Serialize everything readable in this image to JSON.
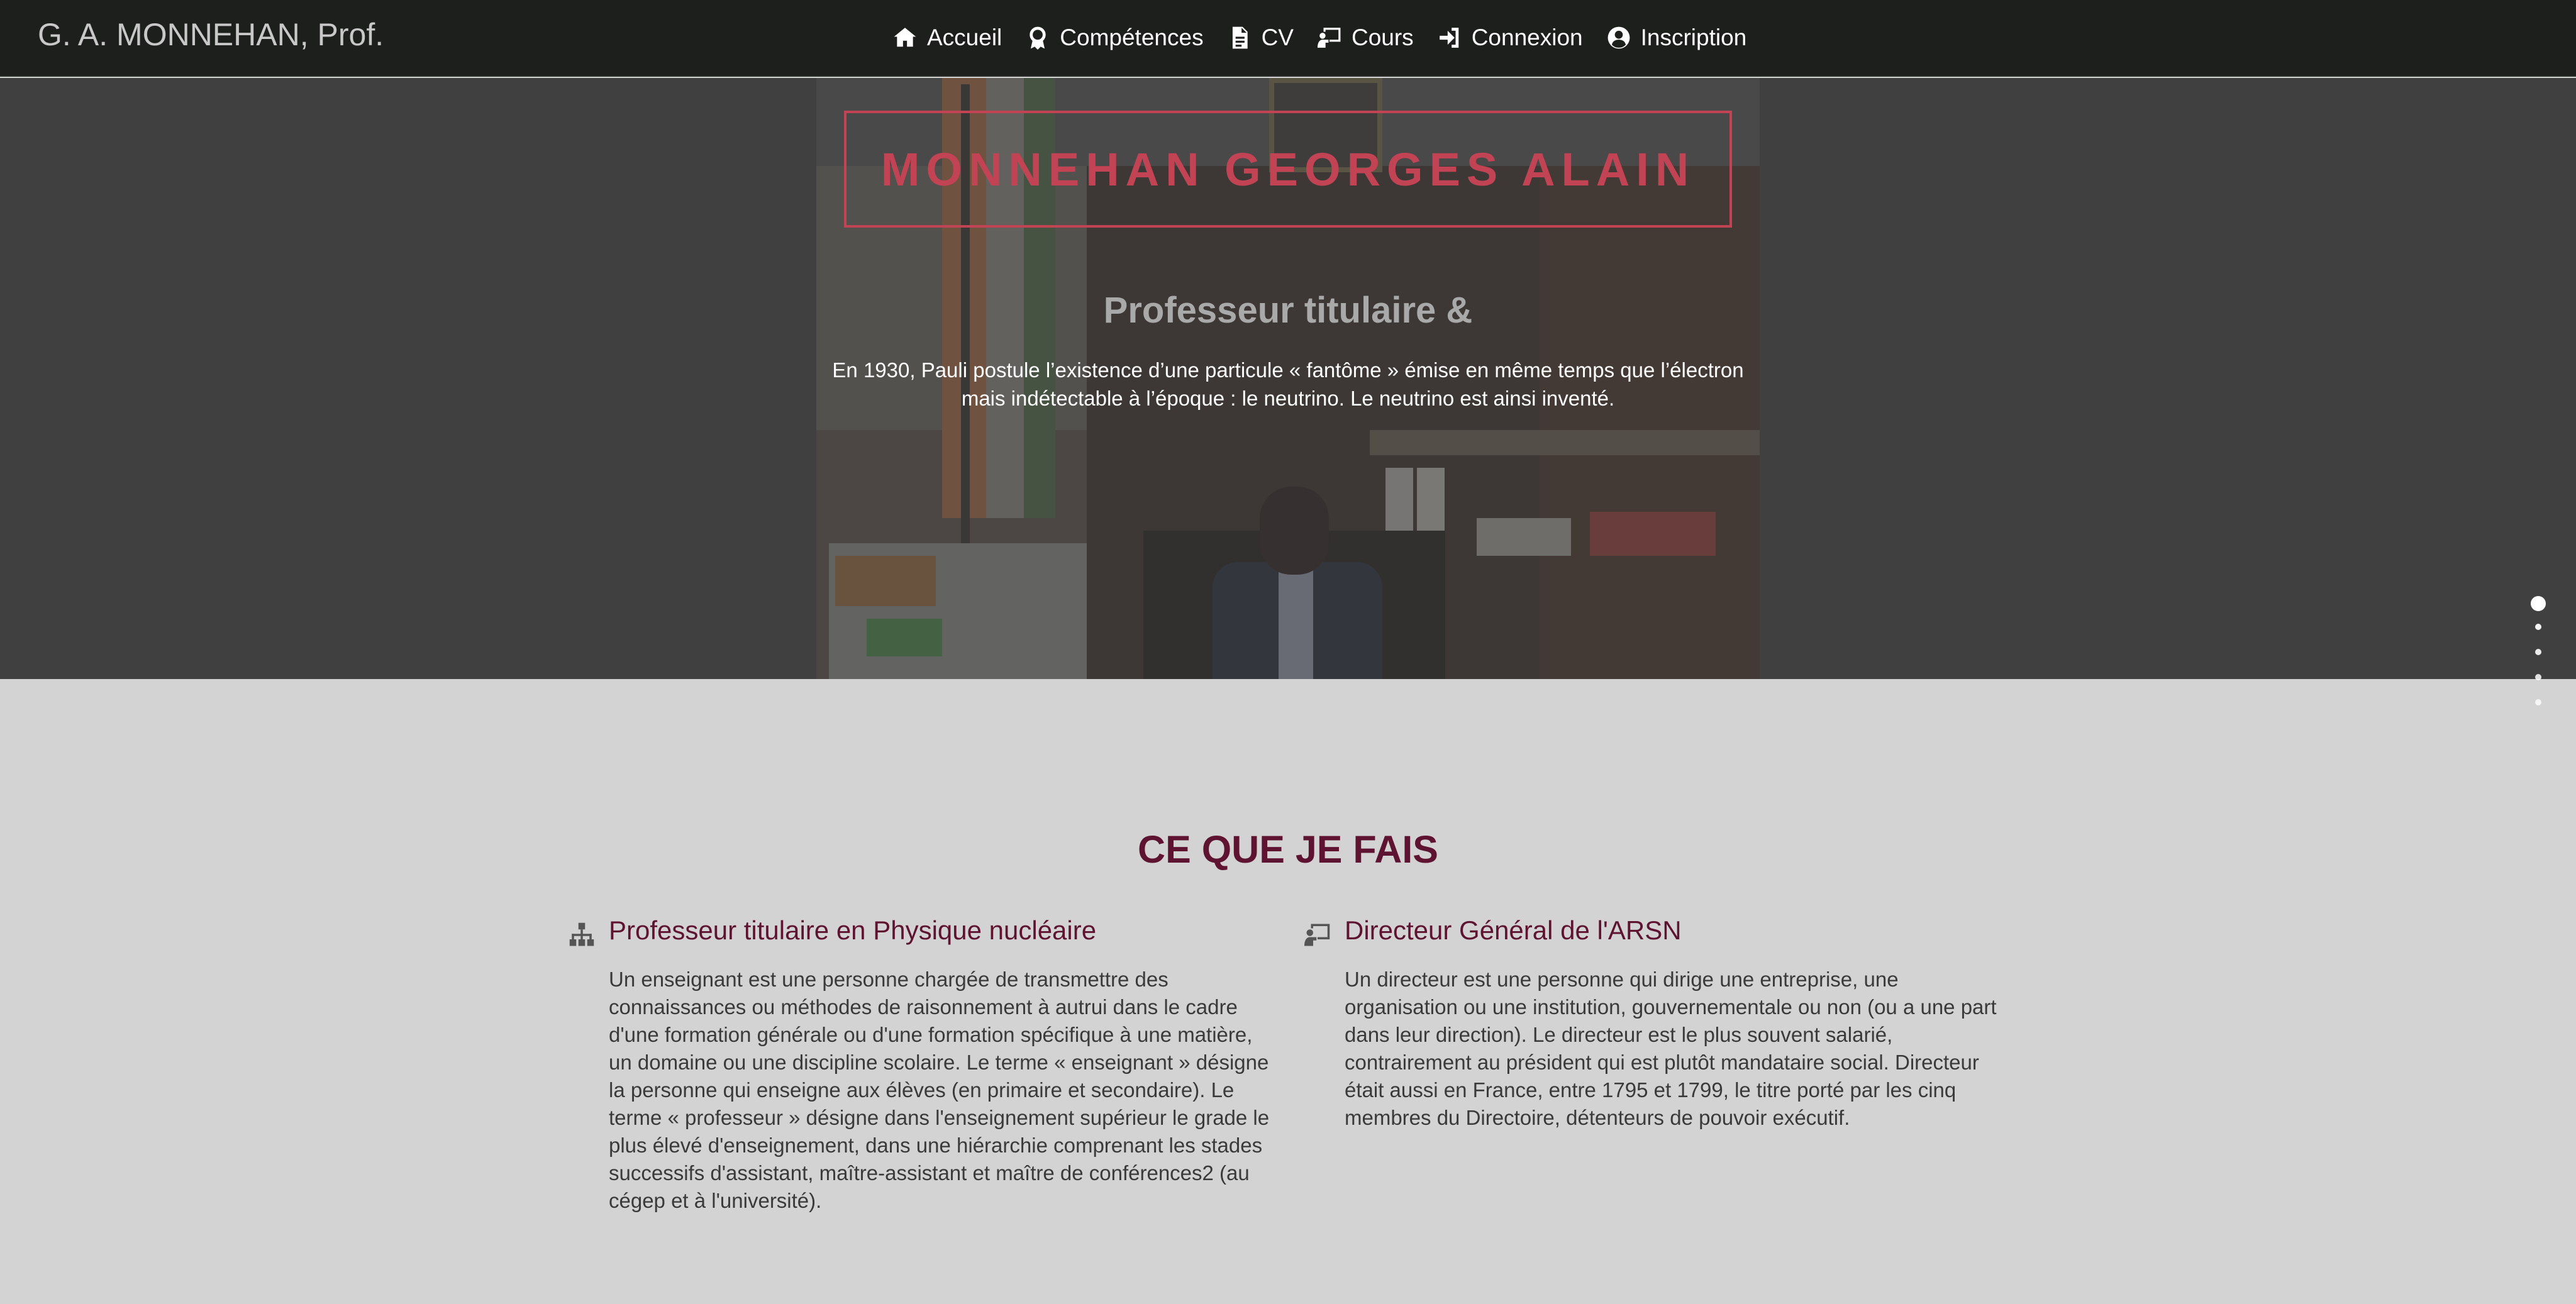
{
  "navbar": {
    "brand": "G. A. MONNEHAN, Prof.",
    "items": [
      {
        "label": "Accueil",
        "icon": "home-icon"
      },
      {
        "label": "Compétences",
        "icon": "award-icon"
      },
      {
        "label": "CV",
        "icon": "document-icon"
      },
      {
        "label": "Cours",
        "icon": "teacher-icon"
      },
      {
        "label": "Connexion",
        "icon": "sign-in-icon"
      },
      {
        "label": "Inscription",
        "icon": "user-circle-icon"
      }
    ]
  },
  "hero": {
    "name": "MONNEHAN GEORGES ALAIN",
    "subtitle": "Professeur titulaire &",
    "text": "En 1930, Pauli postule l’existence d’une particule « fantôme » émise en même temps que l’électron mais indétectable à l’époque : le neutrino. Le neutrino est ainsi inventé."
  },
  "services": {
    "title": "CE QUE JE FAIS",
    "items": [
      {
        "icon": "sitemap-icon",
        "title": "Professeur titulaire en Physique nucléaire",
        "text": "Un enseignant est une personne chargée de transmettre des connaissances ou méthodes de raisonnement à autrui dans le cadre d'une formation générale ou d'une formation spécifique à une matière, un domaine ou une discipline scolaire. Le terme « enseignant » désigne la personne qui enseigne aux élèves (en primaire et secondaire). Le terme « professeur » désigne dans l'enseignement supérieur le grade le plus élevé d'enseignement, dans une hiérarchie comprenant les stades successifs d'assistant, maître-assistant et maître de conférences2 (au cégep et à l'université)."
      },
      {
        "icon": "presentation-icon",
        "title": "Directeur Général de l'ARSN",
        "text": "Un directeur est une personne qui dirige une entreprise, une organisation ou une institution, gouvernementale ou non (ou a une part dans leur direction). Le directeur est le plus souvent salarié, contrairement au président qui est plutôt mandataire social. Directeur était aussi en France, entre 1795 et 1799, le titre porté par les cinq membres du Directoire, détenteurs de pouvoir exécutif."
      }
    ]
  },
  "colors": {
    "navbar_bg": "#1d1f1d",
    "hero_bg": "#404040",
    "accent_red": "#c24454",
    "heading_maroon": "#5e1430",
    "page_bg": "#d3d3d3"
  }
}
